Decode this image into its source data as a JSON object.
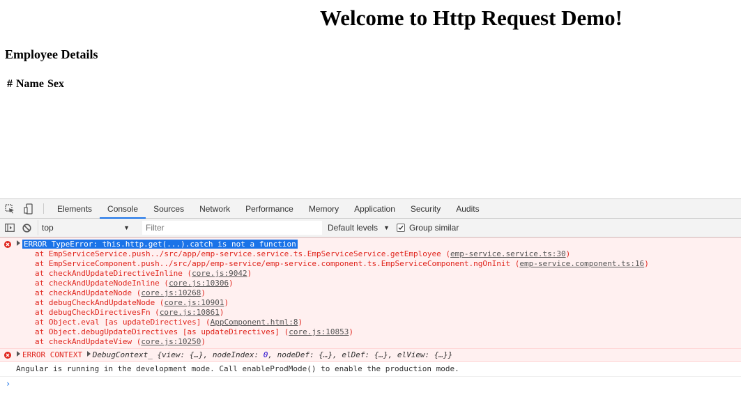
{
  "page": {
    "title": "Welcome to Http Request Demo!",
    "section": "Employee Details",
    "table_headers": [
      "#",
      "Name",
      "Sex"
    ]
  },
  "devtools": {
    "tabs": [
      "Elements",
      "Console",
      "Sources",
      "Network",
      "Performance",
      "Memory",
      "Application",
      "Security",
      "Audits"
    ],
    "active_tab": "Console",
    "toolbar": {
      "context": "top",
      "filter_placeholder": "Filter",
      "levels": "Default levels",
      "group_similar": "Group similar",
      "group_similar_checked": true
    },
    "console": {
      "error_message": "ERROR TypeError: this.http.get(...).catch is not a function",
      "stack": [
        {
          "prefix": "at EmpServiceService.push../src/app/emp-service.service.ts.EmpServiceService.getEmployee (",
          "link": "emp-service.service.ts:30",
          "suffix": ")"
        },
        {
          "prefix": "at EmpServiceComponent.push../src/app/emp-service/emp-service.component.ts.EmpServiceComponent.ngOnInit (",
          "link": "emp-service.component.ts:16",
          "suffix": ")"
        },
        {
          "prefix": "at checkAndUpdateDirectiveInline (",
          "link": "core.js:9042",
          "suffix": ")"
        },
        {
          "prefix": "at checkAndUpdateNodeInline (",
          "link": "core.js:10306",
          "suffix": ")"
        },
        {
          "prefix": "at checkAndUpdateNode (",
          "link": "core.js:10268",
          "suffix": ")"
        },
        {
          "prefix": "at debugCheckAndUpdateNode (",
          "link": "core.js:10901",
          "suffix": ")"
        },
        {
          "prefix": "at debugCheckDirectivesFn (",
          "link": "core.js:10861",
          "suffix": ")"
        },
        {
          "prefix": "at Object.eval [as updateDirectives] (",
          "link": "AppComponent.html:8",
          "suffix": ")"
        },
        {
          "prefix": "at Object.debugUpdateDirectives [as updateDirectives] (",
          "link": "core.js:10853",
          "suffix": ")"
        },
        {
          "prefix": "at checkAndUpdateView (",
          "link": "core.js:10250",
          "suffix": ")"
        }
      ],
      "context_label": "ERROR CONTEXT",
      "context_type": "DebugContext_",
      "context_parts": {
        "open": "{view: {…}, nodeIndex: ",
        "node_index": "0",
        "close": ", nodeDef: {…}, elDef: {…}, elView: {…}}"
      },
      "info": "Angular is running in the development mode. Call enableProdMode() to enable the production mode.",
      "prompt": "›"
    }
  },
  "colors": {
    "error_text": "#e0261e",
    "error_bg": "#fff0f0",
    "active_tab_underline": "#1a73e8",
    "selection": "#1a73e8"
  }
}
